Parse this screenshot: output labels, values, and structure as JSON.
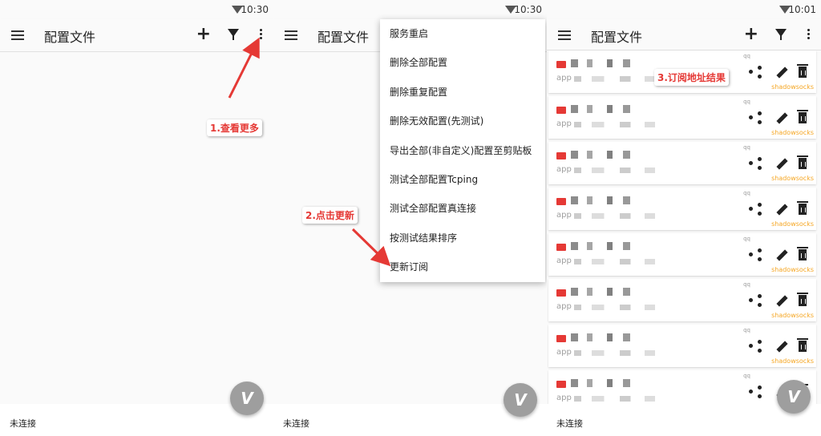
{
  "app": {
    "title": "配置文件",
    "footer_status": "未连接",
    "fab_glyph": "V"
  },
  "panels": [
    {
      "time": "10:30"
    },
    {
      "time": "10:30"
    },
    {
      "time": "10:01"
    }
  ],
  "overflow_menu": {
    "items": [
      "服务重启",
      "删除全部配置",
      "删除重复配置",
      "删除无效配置(先测试)",
      "导出全部(非自定义)配置至剪贴板",
      "测试全部配置Tcping",
      "测试全部配置真连接",
      "按测试结果排序",
      "更新订阅"
    ]
  },
  "annotations": {
    "step1": "1.查看更多",
    "step2": "2.点击更新",
    "step3": "3.订阅地址结果"
  },
  "server_list": {
    "cards": [
      {
        "prefix": "app",
        "tag": "qq",
        "type": "shadowsocks"
      },
      {
        "prefix": "app",
        "tag": "qq",
        "type": "shadowsocks"
      },
      {
        "prefix": "app",
        "tag": "qq",
        "type": "shadowsocks"
      },
      {
        "prefix": "app",
        "tag": "qq",
        "type": "shadowsocks"
      },
      {
        "prefix": "app",
        "tag": "qq",
        "type": "shadowsocks"
      },
      {
        "prefix": "app",
        "tag": "qq",
        "type": "shadowsocks"
      },
      {
        "prefix": "app",
        "tag": "qq",
        "type": "shadowsocks"
      },
      {
        "prefix": "app",
        "tag": "qq",
        "type": ""
      }
    ]
  },
  "icons": {
    "menu": "hamburger-menu-icon",
    "add": "plus-icon",
    "filter": "filter-icon",
    "more": "more-vertical-icon",
    "wifi": "wifi-icon",
    "share": "share-icon",
    "edit": "pencil-icon",
    "delete": "trash-icon",
    "flag": "flag-icon"
  },
  "colors": {
    "annotation_text": "#e53935",
    "fab": "#9e9e9e",
    "protocol_label": "#f5a623"
  }
}
